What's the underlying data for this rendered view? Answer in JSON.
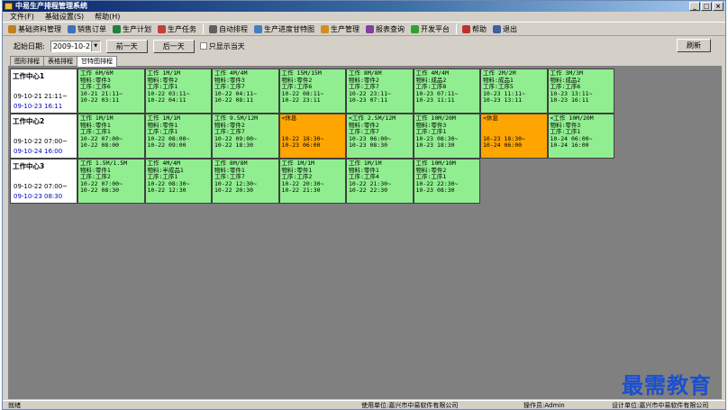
{
  "window": {
    "title": "中易生产排程管理系统",
    "controls": [
      "_",
      "□",
      "×"
    ]
  },
  "menu": [
    {
      "label": "文件(F)"
    },
    {
      "label": "基础设置(S)"
    },
    {
      "label": "帮助(H)"
    }
  ],
  "toolbar": [
    {
      "label": "基础资料管理",
      "icon": "database-icon",
      "color": "#c08020"
    },
    {
      "label": "销售订单",
      "icon": "order-icon",
      "color": "#4070c0"
    },
    {
      "label": "生产计划",
      "icon": "plan-icon",
      "color": "#208040"
    },
    {
      "label": "生产任务",
      "icon": "task-icon",
      "color": "#c04040"
    },
    {
      "label": "自动排程",
      "icon": "auto-schedule-icon",
      "color": "#606060"
    },
    {
      "label": "生产进度甘特图",
      "icon": "gantt-icon",
      "color": "#4080c0"
    },
    {
      "label": "生产管理",
      "icon": "manage-icon",
      "color": "#d09020"
    },
    {
      "label": "报表查询",
      "icon": "report-icon",
      "color": "#8040a0"
    },
    {
      "label": "开发平台",
      "icon": "dev-icon",
      "color": "#30a030"
    },
    {
      "label": "帮助",
      "icon": "help-icon",
      "color": "#c03030"
    },
    {
      "label": "退出",
      "icon": "exit-icon",
      "color": "#4060a0"
    }
  ],
  "controls": {
    "start_date_label": "起始日期:",
    "start_date_value": "2009-10-21",
    "prev_day": "前一天",
    "next_day": "后一天",
    "today_only": "只显示当天",
    "refresh": "刷新"
  },
  "tabs": [
    {
      "label": "图形排程",
      "active": false
    },
    {
      "label": "表格排程",
      "active": false
    },
    {
      "label": "甘特图排程",
      "active": true
    }
  ],
  "schedule": [
    {
      "center": "工作中心1",
      "start": "09-10-21 21:11~",
      "end": "09-10-23 16:11",
      "tasks": [
        {
          "color": "green",
          "lines": [
            "工作 6M/6M",
            "物料:零件3",
            "工序:工序6",
            "10-21 21:11~",
            "10-22 03:11"
          ]
        },
        {
          "color": "green",
          "lines": [
            "工作 1M/1M",
            "物料:零件2",
            "工序:工序1",
            "10-22 03:11~",
            "10-22 04:11"
          ]
        },
        {
          "color": "green",
          "lines": [
            "工作 4M/4M",
            "物料:零件3",
            "工序:工序7",
            "10-22 04:11~",
            "10-22 08:11"
          ]
        },
        {
          "color": "green",
          "lines": [
            "工作 15M/15M",
            "物料:零件2",
            "工序:工序6",
            "10-22 08:11~",
            "10-22 23:11"
          ]
        },
        {
          "color": "green",
          "lines": [
            "工作 8M/8M",
            "物料:零件2",
            "工序:工序7",
            "10-22 23:11~",
            "10-23 07:11"
          ]
        },
        {
          "color": "green",
          "lines": [
            "工作 4M/4M",
            "物料:成品2",
            "工序:工序8",
            "10-23 07:11~",
            "10-23 11:11"
          ]
        },
        {
          "color": "green",
          "lines": [
            "工作 2M/2M",
            "物料:成品1",
            "工序:工序5",
            "10-23 11:11~",
            "10-23 13:11"
          ]
        },
        {
          "color": "green",
          "lines": [
            "工作 3M/3M",
            "物料:成品2",
            "工序:工序6",
            "10-23 13:11~",
            "10-23 16:11"
          ]
        }
      ]
    },
    {
      "center": "工作中心2",
      "start": "09-10-22 07:00~",
      "end": "09-10-24 16:00",
      "tasks": [
        {
          "color": "green",
          "lines": [
            "工作 1M/1M",
            "物料:零件1",
            "工序:工序1",
            "10-22 07:00~",
            "10-22 08:00"
          ]
        },
        {
          "color": "green",
          "lines": [
            "工作 1M/1M",
            "物料:零件1",
            "工序:工序1",
            "10-22 08:00~",
            "10-22 09:00"
          ]
        },
        {
          "color": "green",
          "lines": [
            "工作 9.5M/12M",
            "物料:零件2",
            "工序:工序7",
            "10-22 09:00~",
            "10-22 18:30"
          ]
        },
        {
          "color": "orange",
          "lines": [
            "<休息",
            "",
            "",
            "10-22 18:30~",
            "10-23 06:00"
          ]
        },
        {
          "color": "green",
          "lines": [
            "<工作 2.5M/12M",
            "物料:零件2",
            "工序:工序7",
            "10-23 06:00~",
            "10-23 08:30"
          ]
        },
        {
          "color": "green",
          "lines": [
            "工作 10M/20M",
            "物料:零件3",
            "工序:工序1",
            "10-23 08:30~",
            "10-23 18:30"
          ]
        },
        {
          "color": "orange",
          "lines": [
            "<休息",
            "",
            "",
            "10-23 18:30~",
            "10-24 06:00"
          ]
        },
        {
          "color": "green",
          "lines": [
            "<工作 10M/20M",
            "物料:零件3",
            "工序:工序1",
            "10-24 06:00~",
            "10-24 16:00"
          ]
        }
      ]
    },
    {
      "center": "工作中心3",
      "start": "09-10-22 07:00~",
      "end": "09-10-23 08:30",
      "tasks": [
        {
          "color": "green",
          "lines": [
            "工作 1.5M/1.5M",
            "物料:零件1",
            "工序:工序2",
            "10-22 07:00~",
            "10-22 08:30"
          ]
        },
        {
          "color": "green",
          "lines": [
            "工作 4M/4M",
            "物料:半成品1",
            "工序:工序1",
            "10-22 08:30~",
            "10-22 12:30"
          ]
        },
        {
          "color": "green",
          "lines": [
            "工作 8M/8M",
            "物料:零件1",
            "工序:工序7",
            "10-22 12:30~",
            "10-22 20:30"
          ]
        },
        {
          "color": "green",
          "lines": [
            "工作 1M/1M",
            "物料:零件1",
            "工序:工序2",
            "10-22 20:30~",
            "10-22 21:30"
          ]
        },
        {
          "color": "green",
          "lines": [
            "工作 1M/1M",
            "物料:零件1",
            "工序:工序4",
            "10-22 21:30~",
            "10-22 22:30"
          ]
        },
        {
          "color": "green",
          "lines": [
            "工作 10M/10M",
            "物料:零件2",
            "工序:工序1",
            "10-22 22:30~",
            "10-23 08:30"
          ]
        }
      ]
    }
  ],
  "status": {
    "ready": "就绪",
    "org": "使用单位:嘉兴市中易软件有限公司",
    "operator": "操作员:Admin",
    "designer": "设计单位:嘉兴市中易软件有限公司"
  },
  "watermark": "最需教育"
}
